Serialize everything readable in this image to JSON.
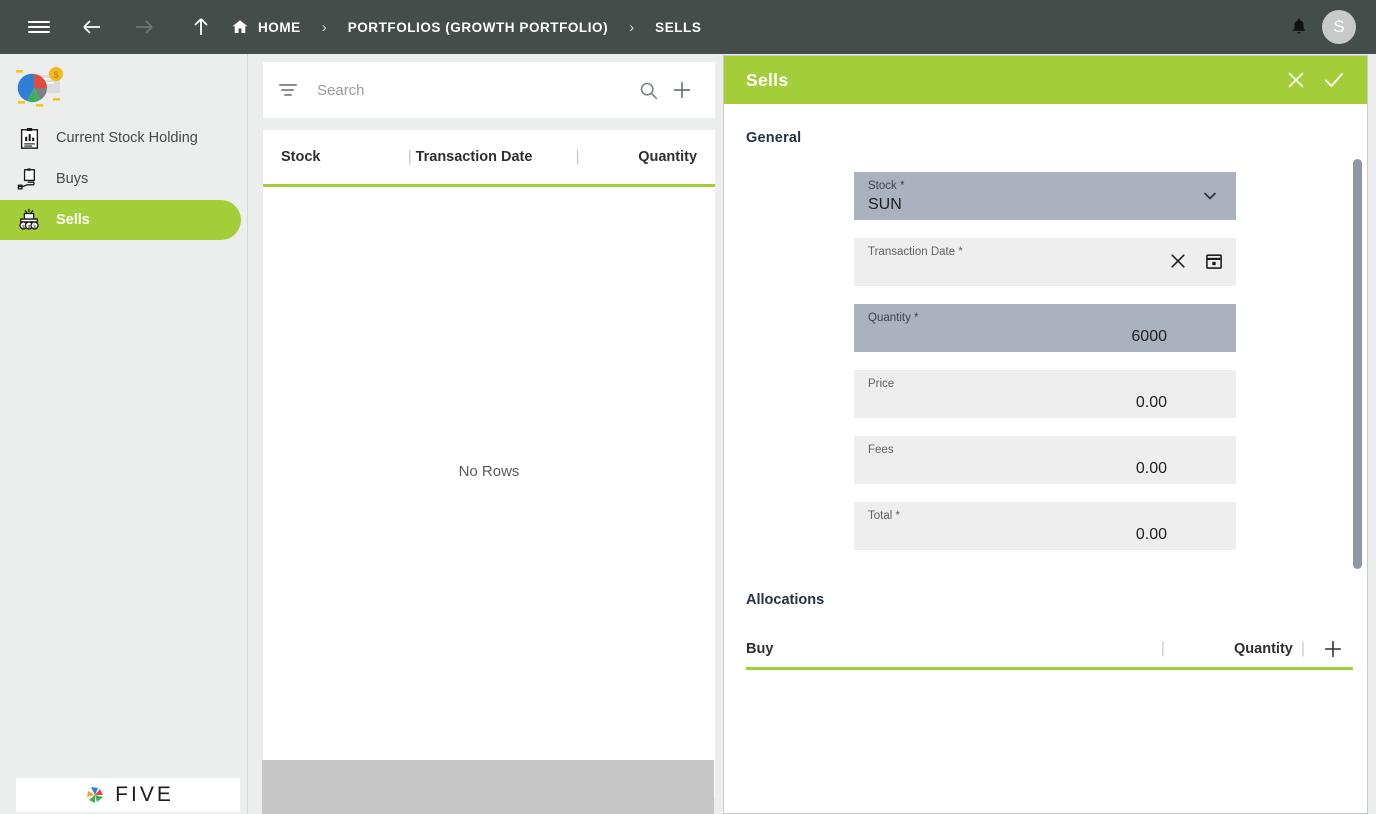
{
  "topbar": {
    "menu_icon": "hamburger-icon",
    "back_icon": "arrow-left-icon",
    "forward_icon": "arrow-right-icon",
    "up_icon": "arrow-up-icon",
    "home_icon": "home-icon",
    "breadcrumbs": [
      {
        "label": "HOME"
      },
      {
        "label": "PORTFOLIOS (GROWTH PORTFOLIO)"
      },
      {
        "label": "SELLS"
      }
    ],
    "separator": "›",
    "notifications_icon": "bell-icon",
    "avatar_initial": "S"
  },
  "sidebar": {
    "logo": "portfolio-pie-logo",
    "items": [
      {
        "label": "Current Stock Holding",
        "icon": "clipboard-chart-icon",
        "active": false
      },
      {
        "label": "Buys",
        "icon": "hand-clipboard-icon",
        "active": false
      },
      {
        "label": "Sells",
        "icon": "money-stack-icon",
        "active": true
      }
    ],
    "footer_logo_text": "FIVE"
  },
  "list_panel": {
    "search": {
      "placeholder": "Search",
      "value": ""
    },
    "filter_icon": "filter-icon",
    "search_icon": "search-icon",
    "add_icon": "plus-icon",
    "columns": [
      "Stock",
      "Transaction Date",
      "Quantity"
    ],
    "column_separator": "|",
    "empty_message": "No Rows",
    "rows": []
  },
  "detail_panel": {
    "title": "Sells",
    "close_icon": "close-icon",
    "confirm_icon": "check-icon",
    "general_section_title": "General",
    "fields": [
      {
        "label": "Stock *",
        "value": "SUN",
        "selected": true,
        "align": "left",
        "trailing_icon": "chevron-down-icon"
      },
      {
        "label": "Transaction Date *",
        "value": "",
        "selected": false,
        "align": "right",
        "trailing_icon": "clear-and-calendar-icons"
      },
      {
        "label": "Quantity *",
        "value": "6000",
        "selected": true,
        "align": "right",
        "trailing_icon": ""
      },
      {
        "label": "Price",
        "value": "0.00",
        "selected": false,
        "align": "right",
        "trailing_icon": ""
      },
      {
        "label": "Fees",
        "value": "0.00",
        "selected": false,
        "align": "right",
        "trailing_icon": ""
      },
      {
        "label": "Total *",
        "value": "0.00",
        "selected": false,
        "align": "right",
        "trailing_icon": ""
      }
    ],
    "allocations": {
      "title": "Allocations",
      "columns": [
        "Buy",
        "Quantity"
      ],
      "column_separator": "|",
      "add_icon": "plus-icon",
      "rows": []
    }
  },
  "colors": {
    "accent_green": "#a4ce39",
    "topbar_dark": "#454d4a",
    "field_selected": "#aab2c0",
    "field_default": "#eeeeee",
    "section_title": "#26324a",
    "scrollbar_thumb": "#8d97a6"
  }
}
